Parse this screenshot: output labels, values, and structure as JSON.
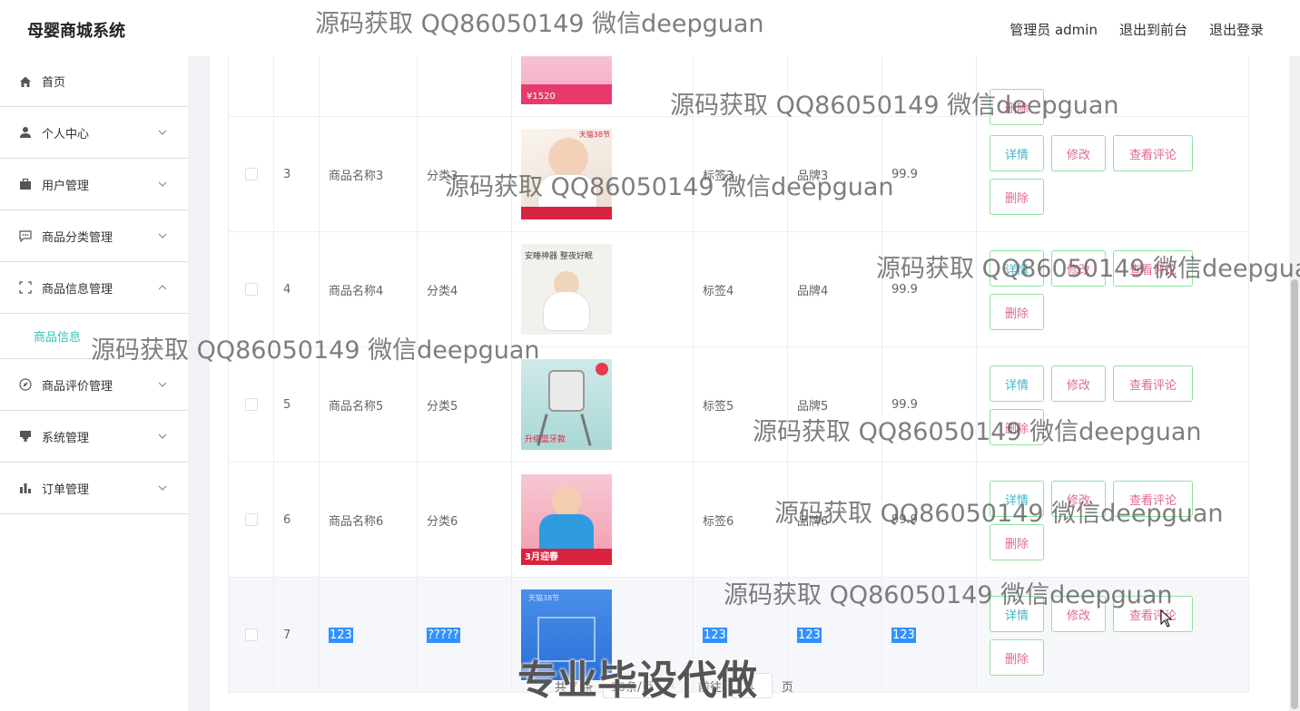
{
  "header": {
    "brand": "母婴商城系统",
    "admin_label": "管理员 admin",
    "to_front": "退出到前台",
    "logout": "退出登录"
  },
  "sidebar": {
    "items": [
      {
        "label": "首页",
        "icon": "home-icon"
      },
      {
        "label": "个人中心",
        "icon": "user-icon"
      },
      {
        "label": "用户管理",
        "icon": "briefcase-icon"
      },
      {
        "label": "商品分类管理",
        "icon": "chat-icon"
      },
      {
        "label": "商品信息管理",
        "icon": "fullscreen-icon"
      },
      {
        "label": "商品评价管理",
        "icon": "compass-icon"
      },
      {
        "label": "系统管理",
        "icon": "stamp-icon"
      },
      {
        "label": "订单管理",
        "icon": "chart-icon"
      }
    ],
    "active_sub": "商品信息"
  },
  "table": {
    "rows": [
      {
        "no": "",
        "name": "",
        "category": "",
        "tag": "",
        "brand": "",
        "price": "",
        "img_text": "¥1520"
      },
      {
        "no": "3",
        "name": "商品名称3",
        "category": "分类3",
        "tag": "标签3",
        "brand": "品牌3",
        "price": "99.9",
        "img_text": "天猫38节"
      },
      {
        "no": "4",
        "name": "商品名称4",
        "category": "分类4",
        "tag": "标签4",
        "brand": "品牌4",
        "price": "99.9",
        "img_text": "安睡神器 整夜好眠"
      },
      {
        "no": "5",
        "name": "商品名称5",
        "category": "分类5",
        "tag": "标签5",
        "brand": "品牌5",
        "price": "99.9",
        "img_text": "升级蓝牙款"
      },
      {
        "no": "6",
        "name": "商品名称6",
        "category": "分类6",
        "tag": "标签6",
        "brand": "品牌6",
        "price": "99.9",
        "img_text": "3月迎春"
      },
      {
        "no": "7",
        "name": "123",
        "category": "?????",
        "tag": "123",
        "brand": "123",
        "price": "123",
        "img_text": "天猫38节"
      }
    ],
    "actions": {
      "detail": "详情",
      "edit": "修改",
      "comment": "查看评论",
      "delete": "删除"
    }
  },
  "pagination": {
    "total": "共 7 条",
    "page_size": "10条/页",
    "goto_prefix": "前往",
    "goto_value": "1",
    "goto_suffix": "页"
  },
  "watermarks": {
    "text": "源码获取 QQ86050149 微信deepguan",
    "big": "专业毕设代做"
  },
  "colors": {
    "accent": "#2ec4b6",
    "button_border": "#8fe3a0",
    "selection": "#3390ff"
  }
}
